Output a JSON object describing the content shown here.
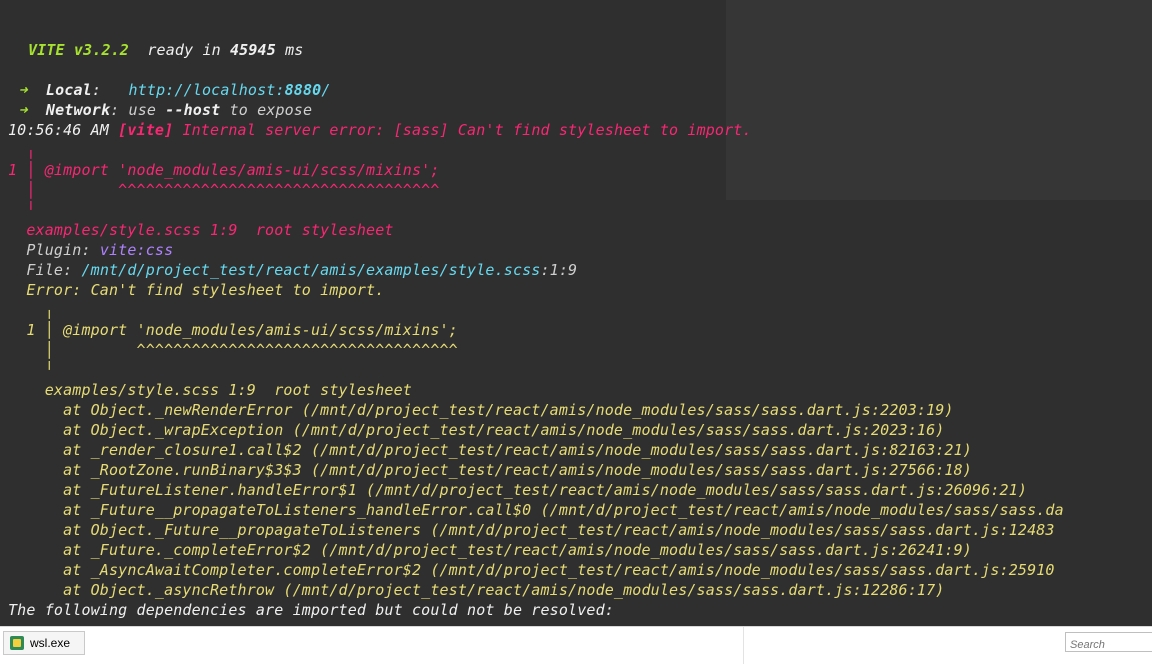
{
  "terminal": {
    "lines": [
      {
        "segments": [
          {
            "t": "VITE v3.2.2",
            "c": "c-green b"
          },
          {
            "t": "  ready in ",
            "c": "c-white"
          },
          {
            "t": "45945",
            "c": "c-white b"
          },
          {
            "t": " ms",
            "c": "c-white"
          }
        ]
      },
      {
        "segments": [
          {
            "t": "  ➜  ",
            "c": "c-green"
          },
          {
            "t": "Local",
            "c": "c-white b"
          },
          {
            "t": ":   ",
            "c": "c-white"
          },
          {
            "t": "http://localhost:",
            "c": "c-cyan"
          },
          {
            "t": "8880",
            "c": "c-cyan b"
          },
          {
            "t": "/",
            "c": "c-cyan"
          }
        ]
      },
      {
        "segments": [
          {
            "t": "  ➜  ",
            "c": "c-green"
          },
          {
            "t": "Network",
            "c": "c-white b"
          },
          {
            "t": ": use ",
            "c": "c-gray"
          },
          {
            "t": "--host",
            "c": "c-white b"
          },
          {
            "t": " to expose",
            "c": "c-gray"
          }
        ]
      },
      {
        "segments": [
          {
            "t": "10:56:46 AM ",
            "c": "c-white"
          },
          {
            "t": "[vite]",
            "c": "c-red b"
          },
          {
            "t": " Internal server error: [sass] Can't find stylesheet to import.",
            "c": "c-red"
          }
        ]
      },
      {
        "segments": [
          {
            "t": "  ╷",
            "c": "c-red"
          }
        ]
      },
      {
        "segments": [
          {
            "t": "1 │ @import 'node_modules/amis-ui/scss/mixins';",
            "c": "c-red"
          }
        ]
      },
      {
        "segments": [
          {
            "t": "  │         ^^^^^^^^^^^^^^^^^^^^^^^^^^^^^^^^^^^",
            "c": "c-red"
          }
        ]
      },
      {
        "segments": [
          {
            "t": "  ╵",
            "c": "c-red"
          }
        ]
      },
      {
        "segments": [
          {
            "t": "  examples/style.scss 1:9  root stylesheet",
            "c": "c-red"
          }
        ]
      },
      {
        "segments": [
          {
            "t": "  Plugin: ",
            "c": "c-gray"
          },
          {
            "t": "vite:css",
            "c": "c-purple"
          }
        ]
      },
      {
        "segments": [
          {
            "t": "  File: ",
            "c": "c-gray"
          },
          {
            "t": "/mnt/d/project_test/react/amis/examples/style.scss",
            "c": "c-cyan"
          },
          {
            "t": ":1:9",
            "c": "c-gray"
          }
        ]
      },
      {
        "segments": [
          {
            "t": "  Error: Can't find stylesheet to import.",
            "c": "c-yellow"
          }
        ]
      },
      {
        "segments": [
          {
            "t": "    ╷",
            "c": "c-yellow"
          }
        ]
      },
      {
        "segments": [
          {
            "t": "  1 │ @import 'node_modules/amis-ui/scss/mixins';",
            "c": "c-yellow"
          }
        ]
      },
      {
        "segments": [
          {
            "t": "    │         ^^^^^^^^^^^^^^^^^^^^^^^^^^^^^^^^^^^",
            "c": "c-yellow"
          }
        ]
      },
      {
        "segments": [
          {
            "t": "    ╵",
            "c": "c-yellow"
          }
        ]
      },
      {
        "segments": [
          {
            "t": "    examples/style.scss 1:9  root stylesheet",
            "c": "c-yellow"
          }
        ]
      },
      {
        "segments": [
          {
            "t": "      at Object._newRenderError (/mnt/d/project_test/react/amis/node_modules/sass/sass.dart.js:2203:19)",
            "c": "c-yellow"
          }
        ]
      },
      {
        "segments": [
          {
            "t": "      at Object._wrapException (/mnt/d/project_test/react/amis/node_modules/sass/sass.dart.js:2023:16)",
            "c": "c-yellow"
          }
        ]
      },
      {
        "segments": [
          {
            "t": "      at _render_closure1.call$2 (/mnt/d/project_test/react/amis/node_modules/sass/sass.dart.js:82163:21)",
            "c": "c-yellow"
          }
        ]
      },
      {
        "segments": [
          {
            "t": "      at _RootZone.runBinary$3$3 (/mnt/d/project_test/react/amis/node_modules/sass/sass.dart.js:27566:18)",
            "c": "c-yellow"
          }
        ]
      },
      {
        "segments": [
          {
            "t": "      at _FutureListener.handleError$1 (/mnt/d/project_test/react/amis/node_modules/sass/sass.dart.js:26096:21)",
            "c": "c-yellow"
          }
        ]
      },
      {
        "segments": [
          {
            "t": "      at _Future__propagateToListeners_handleError.call$0 (/mnt/d/project_test/react/amis/node_modules/sass/sass.da",
            "c": "c-yellow"
          }
        ]
      },
      {
        "segments": [
          {
            "t": "      at Object._Future__propagateToListeners (/mnt/d/project_test/react/amis/node_modules/sass/sass.dart.js:12483",
            "c": "c-yellow"
          }
        ]
      },
      {
        "segments": [
          {
            "t": "      at _Future._completeError$2 (/mnt/d/project_test/react/amis/node_modules/sass/sass.dart.js:26241:9)",
            "c": "c-yellow"
          }
        ]
      },
      {
        "segments": [
          {
            "t": "      at _AsyncAwaitCompleter.completeError$2 (/mnt/d/project_test/react/amis/node_modules/sass/sass.dart.js:25910",
            "c": "c-yellow"
          }
        ]
      },
      {
        "segments": [
          {
            "t": "      at Object._asyncRethrow (/mnt/d/project_test/react/amis/node_modules/sass/sass.dart.js:12286:17)",
            "c": "c-yellow"
          }
        ]
      },
      {
        "segments": [
          {
            "t": "The following dependencies are imported but could not be resolved:",
            "c": "c-white"
          }
        ]
      }
    ]
  },
  "taskbar": {
    "app_label": "wsl.exe",
    "search_placeholder": "Search"
  }
}
